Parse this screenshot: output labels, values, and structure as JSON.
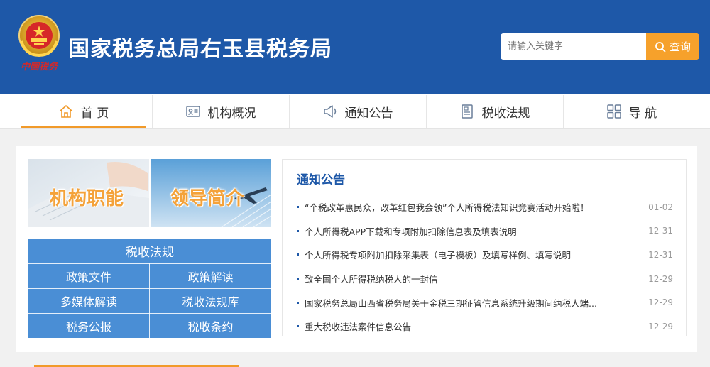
{
  "header": {
    "title": "国家税务总局右玉县税务局",
    "emblem_caption": "中国税务",
    "colors": {
      "background": "#1e58a8",
      "accent": "#f6a12b"
    }
  },
  "search": {
    "placeholder": "请输入关键字",
    "button_label": "查询",
    "button_icon": "search-icon"
  },
  "nav": {
    "items": [
      {
        "label": "首 页",
        "icon": "home-icon",
        "active": true
      },
      {
        "label": "机构概况",
        "icon": "id-card-icon"
      },
      {
        "label": "通知公告",
        "icon": "megaphone-icon"
      },
      {
        "label": "税收法规",
        "icon": "document-icon"
      },
      {
        "label": "导 航",
        "icon": "grid-icon"
      }
    ]
  },
  "banners": [
    {
      "label": "机构职能"
    },
    {
      "label": "领导简介"
    }
  ],
  "tax_law": {
    "title": "税收法规",
    "links": [
      "政策文件",
      "政策解读",
      "多媒体解读",
      "税收法规库",
      "税务公报",
      "税收条约"
    ]
  },
  "notice": {
    "title": "通知公告",
    "items": [
      {
        "text": "“个税改革惠民众，改革红包我会领”个人所得税法知识竞赛活动开始啦！",
        "date": "01-02"
      },
      {
        "text": "个人所得税APP下载和专项附加扣除信息表及填表说明",
        "date": "12-31"
      },
      {
        "text": "个人所得税专项附加扣除采集表（电子模板）及填写样例、填写说明",
        "date": "12-31"
      },
      {
        "text": "致全国个人所得税纳税人的一封信",
        "date": "12-29"
      },
      {
        "text": "国家税务总局山西省税务局关于金税三期征管信息系统升级期间纳税人端...",
        "date": "12-29"
      },
      {
        "text": "重大税收违法案件信息公告",
        "date": "12-29"
      }
    ]
  }
}
